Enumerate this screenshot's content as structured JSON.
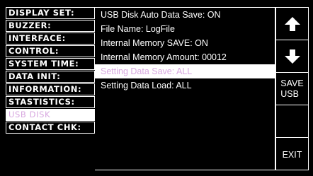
{
  "menu": {
    "items": [
      {
        "label": "DISPLAY SET:"
      },
      {
        "label": "BUZZER:"
      },
      {
        "label": "INTERFACE:"
      },
      {
        "label": "CONTROL:"
      },
      {
        "label": "SYSTEM TIME:"
      },
      {
        "label": "DATA INIT:"
      },
      {
        "label": "INFORMATION:"
      },
      {
        "label": "STASTISTICS:"
      },
      {
        "label": "USB DISK"
      },
      {
        "label": "CONTACT CHK:"
      }
    ],
    "active_item": "USB DISK"
  },
  "panel": {
    "lines": [
      {
        "text": "USB Disk Auto Data Save: ON"
      },
      {
        "text": "File Name: LogFile"
      },
      {
        "text": "Internal Memory SAVE: ON"
      },
      {
        "text": "Internal Memory Amount: 00012"
      },
      {
        "text": "Setting Data Save: ALL"
      },
      {
        "text": "Setting Data Load: ALL"
      }
    ],
    "highlighted_line": "Setting Data Save: ALL"
  },
  "buttons": {
    "up_icon": "arrow-up-icon",
    "down_icon": "arrow-down-icon",
    "save_usb_line1": "SAVE",
    "save_usb_line2": "USB",
    "blank": "",
    "exit": "EXIT"
  },
  "colors": {
    "background": "#000000",
    "foreground": "#ffffff",
    "highlight_text": "#d8a8e0"
  }
}
